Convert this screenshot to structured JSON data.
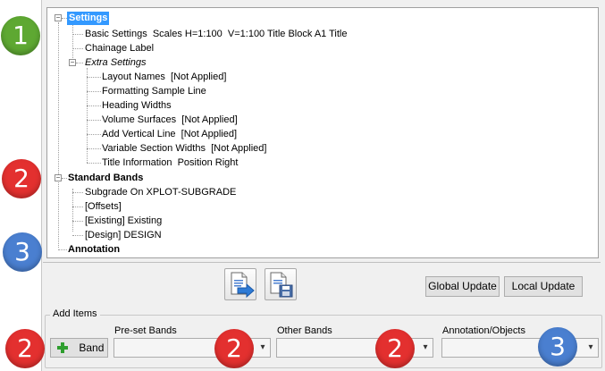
{
  "tree": {
    "settings": "Settings",
    "basic_settings": "Basic Settings  Scales H=1:100  V=1:100 Title Block A1 Title",
    "chainage_label": "Chainage Label",
    "extra_settings": "Extra Settings",
    "layout_names": "Layout Names  [Not Applied]",
    "formatting_sample_line": "Formatting Sample Line",
    "heading_widths": "Heading Widths",
    "volume_surfaces": "Volume Surfaces  [Not Applied]",
    "add_vertical_line": "Add Vertical Line  [Not Applied]",
    "variable_section_widths": "Variable Section Widths  [Not Applied]",
    "title_information": "Title Information  Position Right",
    "standard_bands": "Standard Bands",
    "subgrade": "Subgrade On XPLOT-SUBGRADE",
    "offsets": "[Offsets]",
    "existing": "[Existing] Existing",
    "design": "[Design] DESIGN",
    "annotation": "Annotation"
  },
  "buttons": {
    "global_update": "Global Update",
    "local_update": "Local Update",
    "band": "Band"
  },
  "add_items": {
    "group_label": "Add Items",
    "preset_bands_label": "Pre-set Bands",
    "other_bands_label": "Other Bands",
    "annotation_objects_label": "Annotation/Objects",
    "preset_bands_value": "",
    "other_bands_value": "",
    "annotation_objects_value": ""
  },
  "badges": {
    "b1": "1",
    "b2a": "2",
    "b3a": "3",
    "b2b": "2",
    "b2c": "2",
    "b2d": "2",
    "b3b": "3"
  },
  "colors": {
    "green_badge": "#5ea832",
    "red_badge": "#e3302f",
    "blue_badge": "#4a7fd0",
    "selection": "#3399ff"
  },
  "icons": {
    "expander_open": "⊟",
    "add": "plus-icon",
    "export": "document-arrow-icon",
    "save": "document-save-icon",
    "dropdown": "▾"
  }
}
